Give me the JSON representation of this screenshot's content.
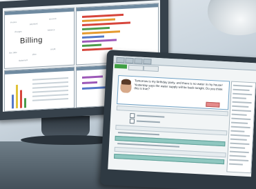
{
  "back_monitor": {
    "app_title": "Billing"
  },
  "laptop": {
    "message": "Tomorrow is my birthday party, and there is no water in my house! Yesterday says the water supply will be back tonight. Do you think this is true?"
  },
  "colors": {
    "bar_colors": [
      "#d6453b",
      "#e59a2f",
      "#4a9b4a",
      "#5478c8",
      "#9c58b8",
      "#e0c33b"
    ],
    "accent_green": "#3f9f45",
    "accent_teal": "#8fc7c0"
  }
}
